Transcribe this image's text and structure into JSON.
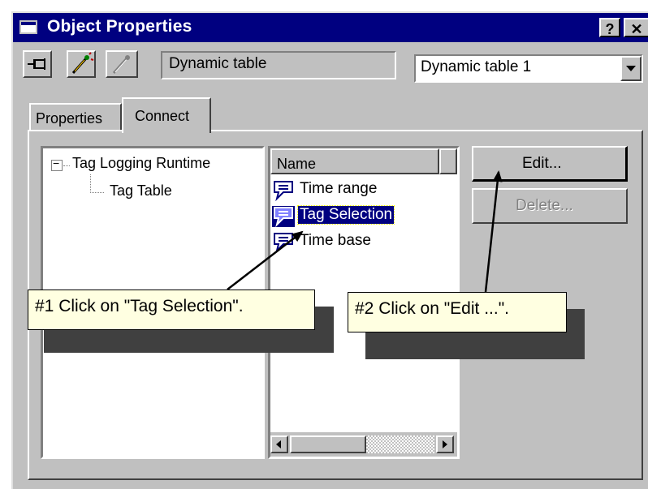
{
  "window": {
    "title": "Object Properties"
  },
  "titlebar_buttons": {
    "help": "?",
    "close": "✕"
  },
  "toolbar": {
    "object_type": "Dynamic table",
    "object_name": "Dynamic table 1"
  },
  "tabs": [
    {
      "label": "Properties"
    },
    {
      "label": "Connect"
    }
  ],
  "tree": {
    "root": "Tag Logging Runtime",
    "child": "Tag Table",
    "expander": "−"
  },
  "list": {
    "column_header": "Name",
    "items": [
      {
        "label": "Time range",
        "selected": false
      },
      {
        "label": "Tag Selection",
        "selected": true
      },
      {
        "label": "Time base",
        "selected": false
      }
    ]
  },
  "buttons": {
    "edit": "Edit...",
    "delete": "Delete..."
  },
  "callouts": {
    "step1": "#1 Click on \"Tag Selection\".",
    "step2": "#2 Click on \"Edit ...\"."
  },
  "colors": {
    "titlebar": "#000080",
    "face": "#c0c0c0",
    "selection": "#000080",
    "note": "#ffffe1"
  }
}
